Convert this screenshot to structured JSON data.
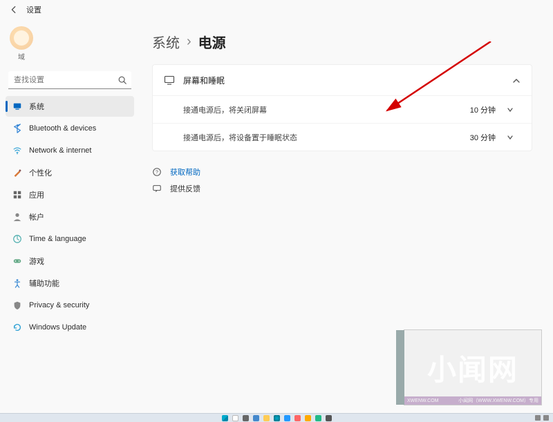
{
  "title": "设置",
  "avatar_label": "域",
  "search": {
    "placeholder": "查找设置"
  },
  "sidebar": {
    "items": [
      {
        "label": "系统"
      },
      {
        "label": "Bluetooth & devices"
      },
      {
        "label": "Network & internet"
      },
      {
        "label": "个性化"
      },
      {
        "label": "应用"
      },
      {
        "label": "帐户"
      },
      {
        "label": "Time & language"
      },
      {
        "label": "游戏"
      },
      {
        "label": "辅助功能"
      },
      {
        "label": "Privacy & security"
      },
      {
        "label": "Windows Update"
      }
    ]
  },
  "breadcrumb": {
    "parent": "系统",
    "current": "电源"
  },
  "panel": {
    "title": "屏幕和睡眠",
    "rows": [
      {
        "label": "接通电源后，将关闭屏幕",
        "value": "10 分钟"
      },
      {
        "label": "接通电源后，将设备置于睡眠状态",
        "value": "30 分钟"
      }
    ]
  },
  "links": {
    "help": "获取帮助",
    "feedback": "提供反馈"
  },
  "colors": {
    "accent": "#0067c0",
    "annotation_red": "#d40000"
  },
  "watermark_text": "小闻网",
  "watermark_footer_left": "XWENW.COM",
  "watermark_footer_right": "小闻网（WWW.XWENW.COM）专用"
}
